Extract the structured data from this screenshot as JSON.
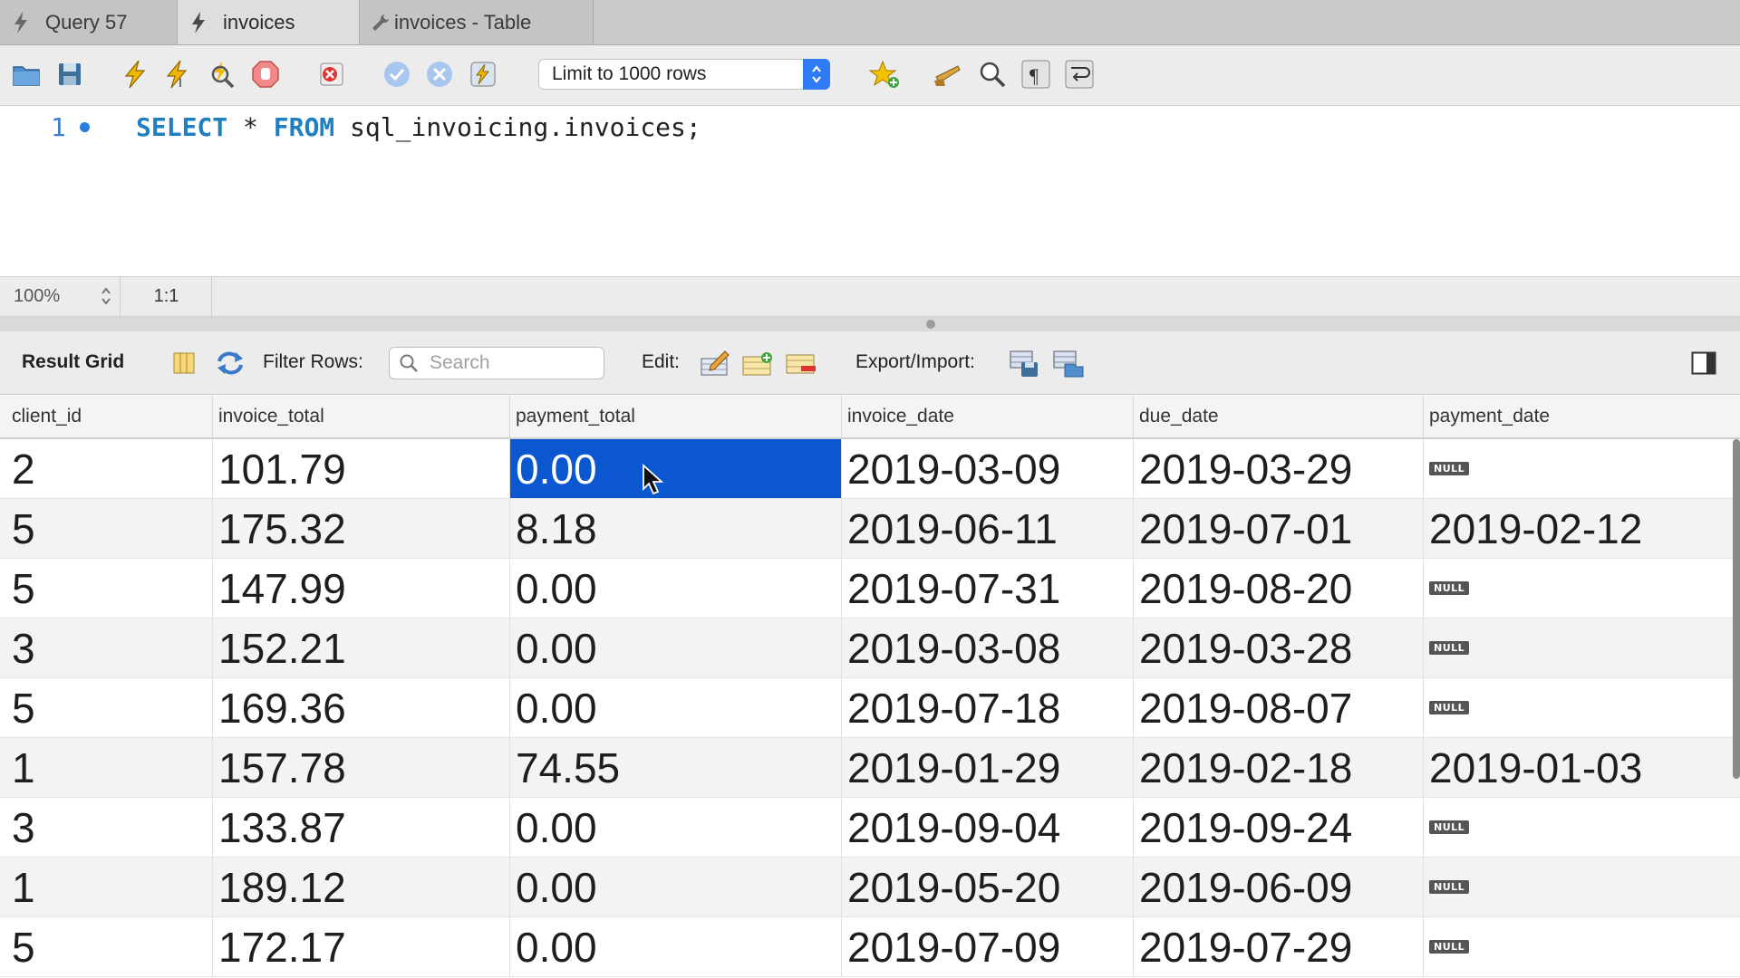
{
  "tabs": [
    {
      "label": "Query 57",
      "icon": "lightning-icon",
      "active": false
    },
    {
      "label": "invoices",
      "icon": "lightning-icon",
      "active": true
    },
    {
      "label": "invoices - Table",
      "icon": "wrench-icon",
      "active": false
    }
  ],
  "toolbar": {
    "limit_label": "Limit to 1000 rows",
    "icons": [
      "open-folder-icon",
      "save-icon",
      "execute-icon",
      "execute-current-icon",
      "explain-icon",
      "stop-icon",
      "error-stop-icon",
      "commit-icon",
      "rollback-icon",
      "autocommit-icon",
      "bookmark-star-icon",
      "beautify-broom-icon",
      "find-icon",
      "invisible-chars-icon",
      "wrap-icon"
    ]
  },
  "editor": {
    "line_number": "1",
    "keyword_select": "SELECT",
    "star": " * ",
    "keyword_from": "FROM",
    "target": " sql_invoicing.invoices;"
  },
  "status": {
    "zoom": "100%",
    "position": "1:1"
  },
  "result_toolbar": {
    "title": "Result Grid",
    "filter_label": "Filter Rows:",
    "search_placeholder": "Search",
    "edit_label": "Edit:",
    "export_label": "Export/Import:"
  },
  "grid": {
    "columns": [
      "client_id",
      "invoice_total",
      "payment_total",
      "invoice_date",
      "due_date",
      "payment_date"
    ],
    "null_text": "NULL",
    "rows": [
      [
        "2",
        "101.79",
        "0.00",
        "2019-03-09",
        "2019-03-29",
        null
      ],
      [
        "5",
        "175.32",
        "8.18",
        "2019-06-11",
        "2019-07-01",
        "2019-02-12"
      ],
      [
        "5",
        "147.99",
        "0.00",
        "2019-07-31",
        "2019-08-20",
        null
      ],
      [
        "3",
        "152.21",
        "0.00",
        "2019-03-08",
        "2019-03-28",
        null
      ],
      [
        "5",
        "169.36",
        "0.00",
        "2019-07-18",
        "2019-08-07",
        null
      ],
      [
        "1",
        "157.78",
        "74.55",
        "2019-01-29",
        "2019-02-18",
        "2019-01-03"
      ],
      [
        "3",
        "133.87",
        "0.00",
        "2019-09-04",
        "2019-09-24",
        null
      ],
      [
        "1",
        "189.12",
        "0.00",
        "2019-05-20",
        "2019-06-09",
        null
      ],
      [
        "5",
        "172.17",
        "0.00",
        "2019-07-09",
        "2019-07-29",
        null
      ]
    ],
    "selected": {
      "row": 0,
      "col": 2
    }
  }
}
